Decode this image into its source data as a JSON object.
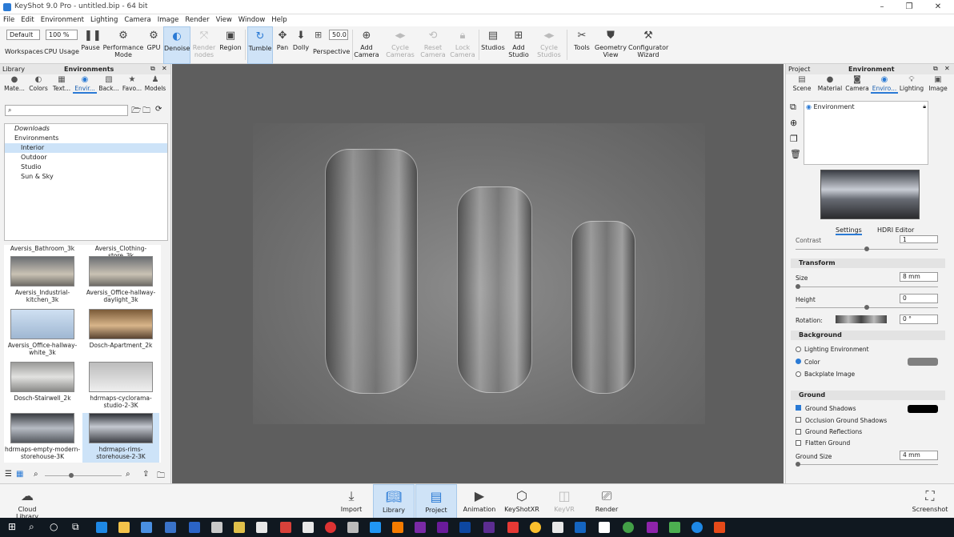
{
  "window": {
    "title": "KeyShot 9.0 Pro - untitled.bip - 64 bit"
  },
  "menu": [
    "File",
    "Edit",
    "Environment",
    "Lighting",
    "Camera",
    "Image",
    "Render",
    "View",
    "Window",
    "Help"
  ],
  "toolbar": {
    "workspace_value": "Default",
    "workspace_label": "Workspaces",
    "cpu_value": "100 %",
    "cpu_label": "CPU Usage",
    "pause": "Pause",
    "performance_mode": "Performance Mode",
    "gpu": "GPU",
    "denoise": "Denoise",
    "render_nodes": "Render nodes",
    "region": "Region",
    "tumble": "Tumble",
    "pan": "Pan",
    "dolly": "Dolly",
    "fov_value": "50.0",
    "perspective": "Perspective",
    "add_camera": "Add Camera",
    "cycle_cameras": "Cycle Cameras",
    "reset_camera": "Reset Camera",
    "lock_camera": "Lock Camera",
    "studios": "Studios",
    "add_studio": "Add Studio",
    "cycle_studios": "Cycle Studios",
    "tools": "Tools",
    "geometry_view": "Geometry View",
    "configurator_wizard": "Configurator Wizard"
  },
  "library": {
    "panel_title": "Library",
    "active_title": "Environments",
    "tabs": [
      "Mate...",
      "Colors",
      "Text...",
      "Envir...",
      "Back...",
      "Favo...",
      "Models"
    ],
    "tree": [
      "Downloads",
      "Environments",
      "Interior",
      "Outdoor",
      "Studio",
      "Sun & Sky"
    ],
    "top_labels": [
      "Aversis_Bathroom_3k",
      "Aversis_Clothing-store_3k"
    ],
    "thumbs": [
      "Aversis_Industrial-kitchen_3k",
      "Aversis_Office-hallway-daylight_3k",
      "Aversis_Office-hallway-white_3k",
      "Dosch-Apartment_2k",
      "Dosch-Stairwell_2k",
      "hdrmaps-cyclorama-studio-2-3K",
      "hdrmaps-empty-modern-storehouse-3K",
      "hdrmaps-rims-storehouse-2-3K"
    ]
  },
  "project": {
    "panel_title": "Project",
    "active_title": "Environment",
    "tabs": [
      "Scene",
      "Material",
      "Camera",
      "Enviro...",
      "Lighting",
      "Image"
    ],
    "env_item": "Environment",
    "subtabs": [
      "Settings",
      "HDRI Editor"
    ],
    "contrast_label": "Contrast",
    "contrast_value": "1",
    "transform_title": "Transform",
    "size_label": "Size",
    "size_value": "8 mm",
    "height_label": "Height",
    "height_value": "0",
    "rotation_label": "Rotation:",
    "rotation_value": "0 °",
    "background_title": "Background",
    "bg_lighting": "Lighting Environment",
    "bg_color": "Color",
    "bg_backplate": "Backplate Image",
    "ground_title": "Ground",
    "ground_shadows": "Ground Shadows",
    "occlusion_shadows": "Occlusion Ground Shadows",
    "ground_reflections": "Ground Reflections",
    "flatten_ground": "Flatten Ground",
    "ground_size_label": "Ground Size",
    "ground_size_value": "4 mm"
  },
  "bottom": {
    "cloud_library": "Cloud Library",
    "import": "Import",
    "library": "Library",
    "project": "Project",
    "animation": "Animation",
    "keyshotxr": "KeyShotXR",
    "keyvr": "KeyVR",
    "render": "Render",
    "screenshot": "Screenshot"
  },
  "colors": {
    "accent": "#2a7ad5",
    "active_bg": "#cfe3f7",
    "background_color_swatch": "#808080",
    "ground_shadow_swatch": "#000000"
  }
}
